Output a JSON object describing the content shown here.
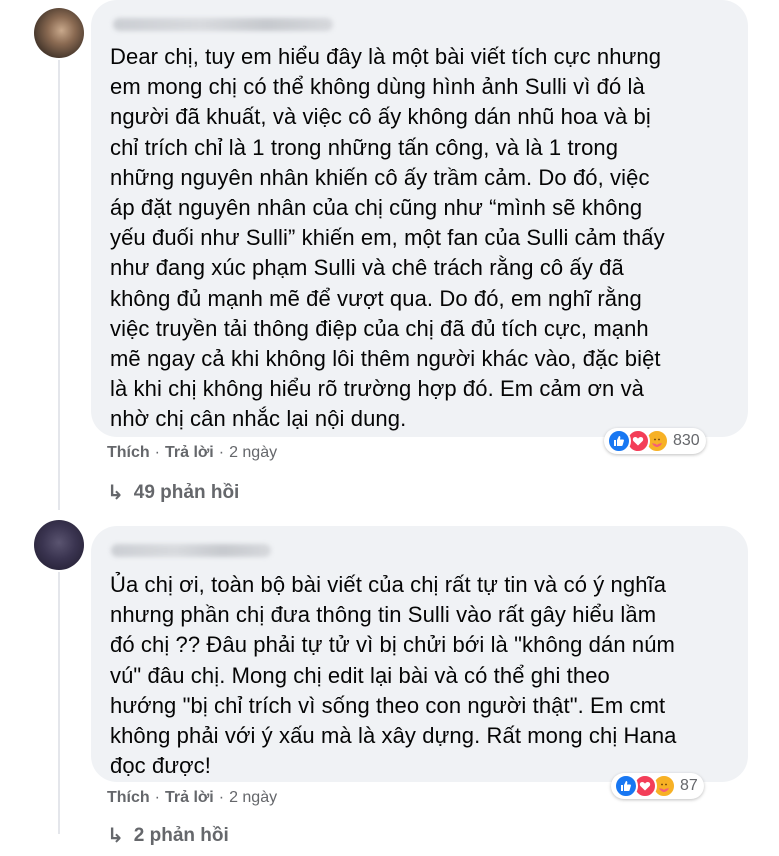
{
  "comments": [
    {
      "text": "Dear chị, tuy em hiểu đây là một bài viết tích cực nhưng\nem mong chị có thể không dùng hình ảnh Sulli vì đó là\nngười đã khuất, và việc cô ấy không dán nhũ hoa và bị\nchỉ trích chỉ là 1 trong những tấn công, và là 1 trong\nnhững nguyên nhân khiến cô ấy trầm cảm. Do đó, việc\náp đặt nguyên nhân của chị cũng như “mình sẽ không\nyếu đuối như Sulli” khiến em, một fan của Sulli cảm thấy\nnhư đang xúc phạm Sulli và chê trách rằng cô ấy đã\nkhông đủ mạnh mẽ để vượt qua. Do đó, em nghĩ rằng\nviệc truyền tải thông điệp của chị đã đủ tích cực, mạnh\nmẽ ngay cả khi không lôi thêm người khác vào, đặc biệt\nlà khi chị không hiểu rõ trường hợp đó. Em cảm ơn và\nnhờ chị cân nhắc lại nội dung.",
      "like_label": "Thích",
      "dot": "·",
      "reply_label": "Trả lời",
      "time": "2 ngày",
      "reaction_count": "830",
      "replies_label": "49 phản hồi",
      "reaction_icons": [
        "like-icon",
        "love-icon",
        "care-icon"
      ]
    },
    {
      "text": "Ủa chị ơi, toàn bộ bài viết của chị rất tự tin và có ý nghĩa\nnhưng phần chị đưa thông tin Sulli vào rất gây hiểu lầm\nđó chị ?? Đâu phải tự tử vì bị chửi bới là \"không dán núm\nvú\" đâu chị. Mong chị edit lại bài và có thể ghi theo\nhướng \"bị chỉ trích vì sống theo con người thật\". Em cmt\nkhông phải với ý xấu mà là xây dựng. Rất mong chị Hana\nđọc được!",
      "like_label": "Thích",
      "dot": "·",
      "reply_label": "Trả lời",
      "time": "2 ngày",
      "reaction_count": "87",
      "replies_label": "2 phản hồi",
      "reaction_icons": [
        "like-icon",
        "love-icon",
        "care-icon"
      ]
    }
  ],
  "icons": {
    "reply_arrow": "↳",
    "like_glyph": "👍",
    "love_glyph": "♥",
    "care_glyph": "☺"
  },
  "colors": {
    "bubble": "#f0f2f5",
    "meta_text": "#65676b",
    "like": "#1877f2",
    "love": "#f33e58",
    "care": "#f7b125"
  }
}
